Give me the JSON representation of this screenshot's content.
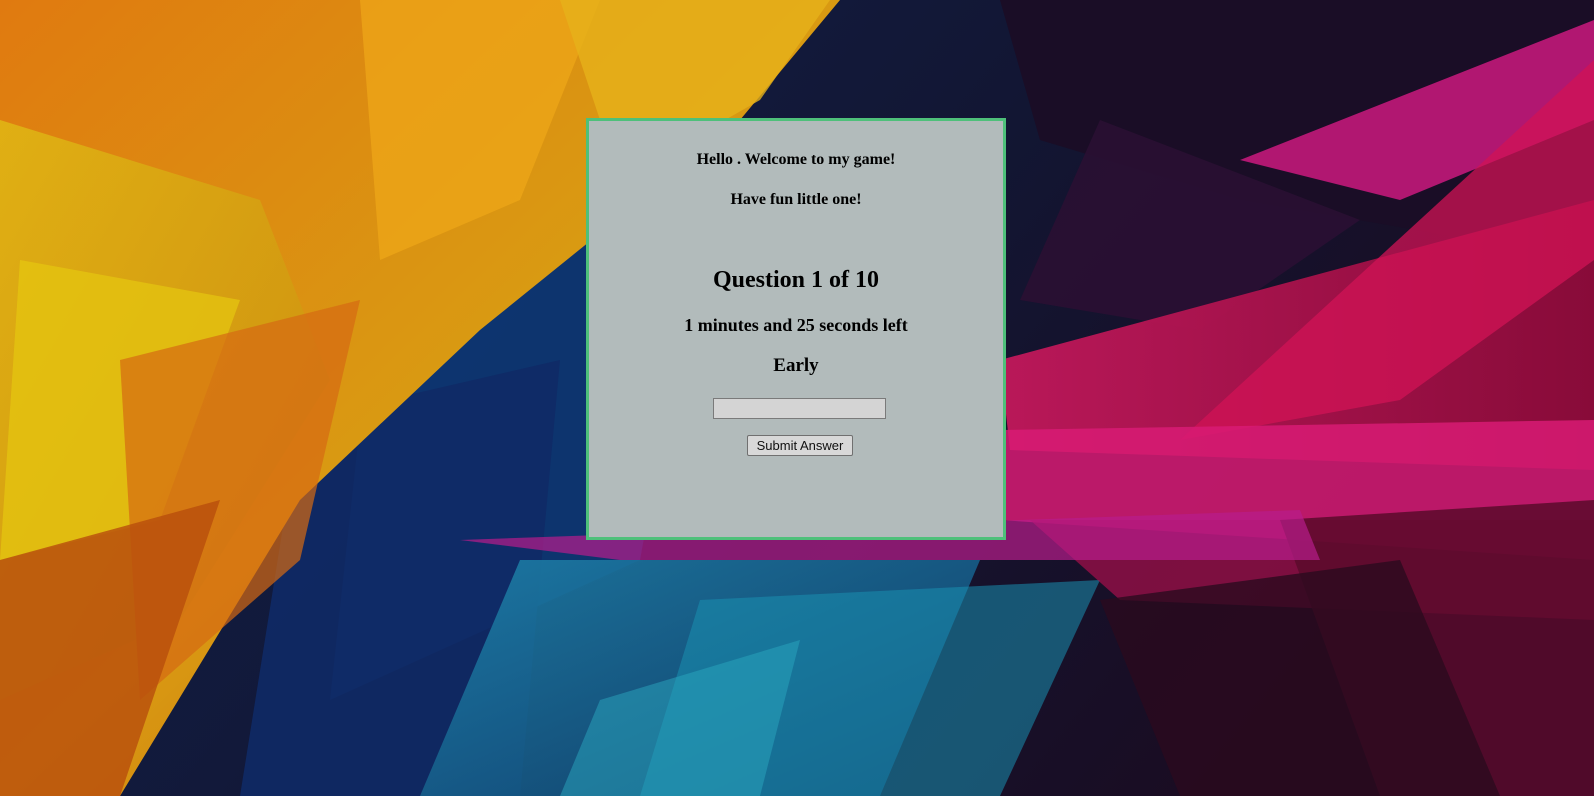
{
  "game": {
    "greeting": "Hello . Welcome to my game!",
    "subgreeting": "Have fun little one!",
    "question_counter": "Question 1 of 10",
    "timer_text": "1 minutes and 25 seconds left",
    "word_prompt": "Early"
  },
  "answer": {
    "value": "",
    "placeholder": ""
  },
  "submit": {
    "label": "Submit Answer"
  },
  "colors": {
    "panel_background": "#b2bbbb",
    "panel_border": "#4ec07a",
    "text": "#000000"
  }
}
